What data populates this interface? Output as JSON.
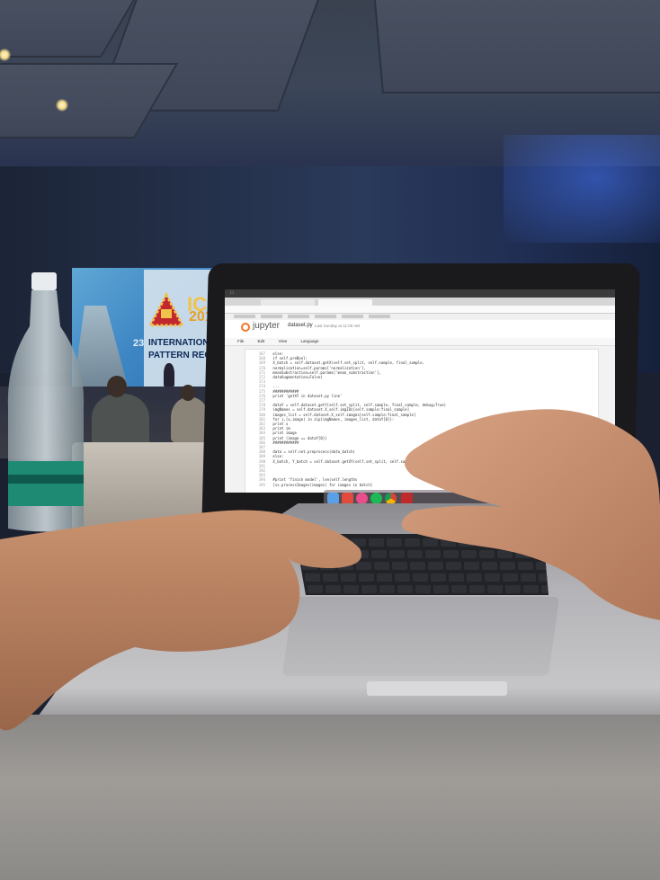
{
  "scene": {
    "description_colors": {
      "ceiling": "#3c4658",
      "wall_glow": "#4678ff",
      "skin": "#c48e70",
      "laptop_silver": "#b4b4b8",
      "desk": "#9f9c98"
    }
  },
  "banner": {
    "logo_text": "ICP",
    "year": "201",
    "number": "23",
    "line1": "INTERNATIONAL CO",
    "line2": "PATTERN RECOGNI"
  },
  "screen": {
    "app_name": "jupyter",
    "notebook_name": "dataset.py",
    "checkpoint": "Last Sunday at 11:00 AM",
    "nb_menu": [
      "File",
      "Edit",
      "View",
      "Language"
    ],
    "code_lines": [
      {
        "num": "167",
        "text": "        else:"
      },
      {
        "num": "168",
        "text": "            if self.preBool:"
      },
      {
        "num": "169",
        "text": "                X_batch = self.dataset.getX(self.set_split, self.sample, final_sample,"
      },
      {
        "num": "170",
        "text": "                                  normalization=self.params['normalization'],"
      },
      {
        "num": "171",
        "text": "                                  meanSubstraction=self.params['mean_substraction'],"
      },
      {
        "num": "172",
        "text": "                                  dataAugmentation=False)"
      },
      {
        "num": "173",
        "text": ""
      },
      {
        "num": "174",
        "text": "                ..."
      },
      {
        "num": "175",
        "text": "                ############"
      },
      {
        "num": "176",
        "text": "                print 'getXY in dataset.py line'"
      },
      {
        "num": "177",
        "text": ""
      },
      {
        "num": "178",
        "text": "                dataY = self.dataset.getY(self.set_split, self.sample, final_sample, debug=True)"
      },
      {
        "num": "179",
        "text": "                imgNames = self.dataset.X_self.imgIDs[self.sample:final_sample]"
      },
      {
        "num": "180",
        "text": "                images_list = self.dataset.X_self.images[self.sample:final_sample]"
      },
      {
        "num": "181",
        "text": "                for i,(x,image) in zip(imgNames, images_list, dataY[0]):"
      },
      {
        "num": "182",
        "text": "                    print x"
      },
      {
        "num": "183",
        "text": "                    print im"
      },
      {
        "num": "184",
        "text": "                    print image"
      },
      {
        "num": "185",
        "text": "                    print (image == dataY[0])"
      },
      {
        "num": "186",
        "text": "                ############"
      },
      {
        "num": "187",
        "text": ""
      },
      {
        "num": "188",
        "text": "                data = self.net.preprocess(data_batch)"
      },
      {
        "num": "189",
        "text": "            else:"
      },
      {
        "num": "190",
        "text": "                X_batch, Y_batch = self.dataset.getXY(self.set_split, self.sample,"
      },
      {
        "num": "191",
        "text": ""
      },
      {
        "num": "192",
        "text": ""
      },
      {
        "num": "193",
        "text": ""
      },
      {
        "num": "194",
        "text": "            #print 'finish model', len(self.lengths"
      },
      {
        "num": "195",
        "text": "            [ss.processImages(images) for images in batch]"
      }
    ]
  },
  "dock_icons": [
    "finder",
    "skype",
    "itunes",
    "spotify",
    "chrome",
    "filezilla",
    "settings",
    "opera",
    "terminal"
  ]
}
